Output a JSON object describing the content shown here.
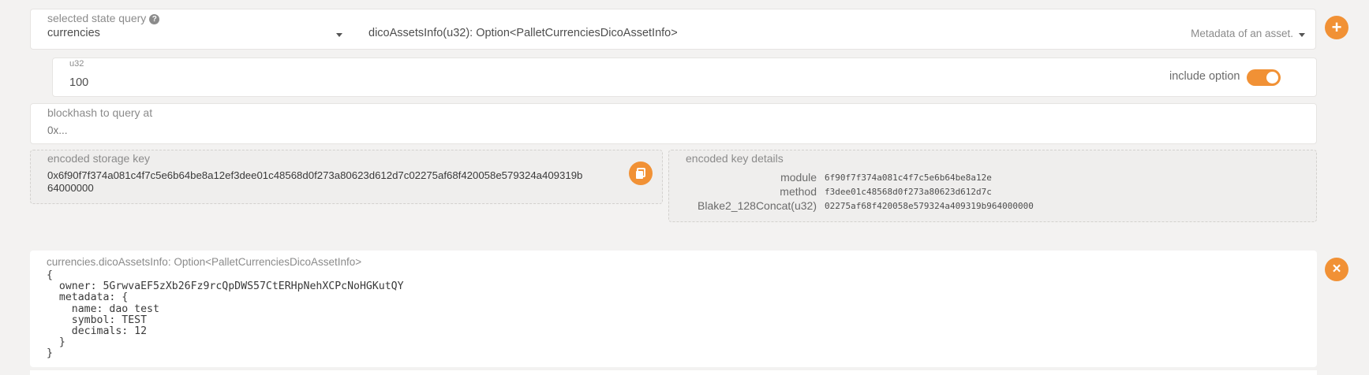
{
  "query_section": {
    "label": "selected state query",
    "help_icon": "question-icon",
    "module": "currencies",
    "method": "dicoAssetsInfo(u32): Option<PalletCurrenciesDicoAssetInfo>",
    "method_description": "Metadata of an asset.",
    "add_button_icon": "plus-icon"
  },
  "param": {
    "type_label": "u32",
    "value": "100",
    "include_option_label": "include option",
    "include_option_enabled": true
  },
  "blockhash": {
    "label": "blockhash to query at",
    "placeholder": "0x..."
  },
  "storage_key": {
    "label": "encoded storage key",
    "line1": "0x6f90f7f374a081c4f7c5e6b64be8a12ef3dee01c48568d0f273a80623d612d7c02275af68f420058e579324a409319b",
    "line2": "64000000",
    "copy_icon": "copy-icon"
  },
  "key_details": {
    "label": "encoded key details",
    "rows": [
      {
        "key": "module",
        "value": "6f90f7f374a081c4f7c5e6b64be8a12e"
      },
      {
        "key": "method",
        "value": "f3dee01c48568d0f273a80623d612d7c"
      },
      {
        "key": "Blake2_128Concat(u32)",
        "value": "02275af68f420058e579324a409319b964000000"
      }
    ]
  },
  "result": {
    "label": "currencies.dicoAssetsInfo: Option<PalletCurrenciesDicoAssetInfo>",
    "lines": [
      "{",
      "  owner: 5GrwvaEF5zXb26Fz9rcQpDWS57CtERHpNehXCPcNoHGKutQY",
      "  metadata: {",
      "    name: dao test",
      "    symbol: TEST",
      "    decimals: 12",
      "  }",
      "}"
    ],
    "close_icon": "close-icon"
  },
  "colors": {
    "accent": "#f19135",
    "background": "#f3f2f1"
  }
}
